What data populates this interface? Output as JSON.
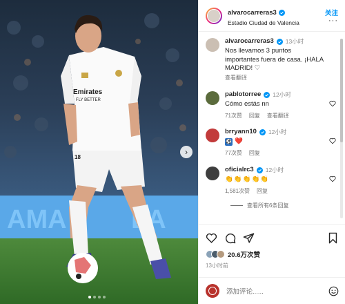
{
  "post": {
    "username": "alvarocarreras3",
    "location": "Estadio Ciudad de Valencia",
    "follow_label": "关注",
    "more_label": "···",
    "likes": "20.6万次赞",
    "time": "13小时前",
    "add_comment_placeholder": "添加评论......"
  },
  "photo": {
    "jersey_sponsor": "Emirates",
    "jersey_sponsor_line2": "FLY BETTER",
    "jersey_number": "18"
  },
  "comments": [
    {
      "username": "alvarocarreras3",
      "time": "13小时",
      "text": "Nos llevamos 3 puntos importantes fuera de casa. ¡HALA MADRID! ♡",
      "translate": "查看翻译",
      "verified": true
    },
    {
      "username": "pablotorree",
      "time": "12小时",
      "text": "Cómo estás nn",
      "likes": "71次赞",
      "reply": "回复",
      "translate": "查看翻译",
      "verified": true
    },
    {
      "username": "brryann10",
      "time": "12小时",
      "text": "❤️",
      "likes": "77次赞",
      "reply": "回复",
      "verified": true
    },
    {
      "username": "oficialrc3",
      "time": "12小时",
      "text": "👏👏👏👏👏",
      "likes": "1,581次赞",
      "reply": "回复",
      "verified": true,
      "view_replies": "查看所有6条回复"
    }
  ],
  "icons": [
    "verified-icon",
    "heart-icon",
    "comment-icon",
    "share-icon",
    "bookmark-icon",
    "emoji-icon",
    "next-arrow-icon"
  ],
  "colors": {
    "accent": "#0095f6",
    "like_red": "#ed4956",
    "text": "#262626",
    "muted": "#737373"
  }
}
